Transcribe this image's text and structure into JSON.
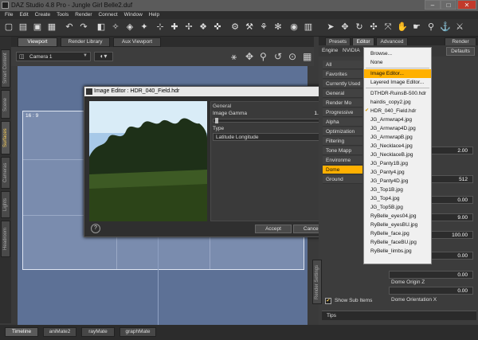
{
  "window": {
    "title": "DAZ Studio 4.8 Pro - Jungle Girl Belle2.duf",
    "min": "–",
    "max": "□",
    "close": "✕"
  },
  "menubar": [
    "File",
    "Edit",
    "Create",
    "Tools",
    "Render",
    "Connect",
    "Window",
    "Help"
  ],
  "left_tabs": [
    "Smart Content",
    "Scene",
    "Surfaces",
    "Cameras",
    "Lights",
    "Headroom"
  ],
  "viewport": {
    "tabs": [
      "Viewport",
      "Render Library",
      "Aux Viewport"
    ],
    "camera": "Camera 1",
    "aspect": "16 : 9"
  },
  "bottom_tabs": [
    "Timeline",
    "aniMate2",
    "rayMate",
    "graphMate"
  ],
  "dialog": {
    "title": "Image Editor : HDR_040_Field.hdr",
    "general_label": "General",
    "gamma_label": "Image Gamma",
    "gamma_value": "1.00",
    "type_label": "Type",
    "type_value": "Latitude Longitude",
    "accept": "Accept",
    "cancel": "Cancel",
    "help": "?"
  },
  "right_panel": {
    "tabs": [
      "Presets",
      "Editor",
      "Advanced"
    ],
    "render_tab": "Render",
    "sub": [
      "Engine",
      "NVIDIA"
    ],
    "defaults": "Defaults",
    "scene_items": [
      "All",
      "Favorites",
      "Currently Used",
      "General",
      "Render Mo",
      "Progressive",
      "Alpha",
      "Optimization",
      "Filtering",
      "Tone Mapp",
      "Environme",
      "Dome",
      "Ground"
    ],
    "props": [
      {
        "label": "Ground",
        "value": ""
      },
      {
        "label": "me",
        "value": ""
      },
      {
        "label": "ty",
        "value": ""
      },
      {
        "label": "",
        "value": "2.00"
      },
      {
        "label": "ng Resolution",
        "value": ""
      },
      {
        "label": "",
        "value": "512"
      },
      {
        "label": "ng Blur",
        "value": ""
      },
      {
        "label": "",
        "value": "0.00"
      },
      {
        "label": "ier",
        "value": ""
      },
      {
        "label": "",
        "value": "9.00"
      },
      {
        "label": "",
        "value": "100.00"
      },
      {
        "label": "",
        "value": "0.00"
      },
      {
        "label": "",
        "value": "0.00"
      },
      {
        "label": "",
        "value": "0.00"
      },
      {
        "label": "Dome Origin Z",
        "value": ""
      },
      {
        "label": "",
        "value": "0.00"
      },
      {
        "label": "Dome Orientation X",
        "value": ""
      }
    ],
    "show_sub_items": "Show Sub Items",
    "tips": "Tips",
    "render_settings": "Render Settings"
  },
  "context_menu": {
    "items": [
      "Browse...",
      "None",
      "Image Editor...",
      "Layered Image Editor...",
      "DTHDR-RuinsB-500.hdr",
      "hairdis_copy2.jpg",
      "HDR_040_Field.hdr",
      "JG_Armwrap4.jpg",
      "JG_Armwrap4D.jpg",
      "JG_ArmwrapB.jpg",
      "JG_Necklace4.jpg",
      "JG_NecklaceB.jpg",
      "JG_Panty1B.jpg",
      "JG_Panty4.jpg",
      "JG_Panty4D.jpg",
      "JG_Top1B.jpg",
      "JG_Top4.jpg",
      "JG_Top5B.jpg",
      "RyBelle_eyes04.jpg",
      "RyBelle_eyesBU.jpg",
      "RyBelle_face.jpg",
      "RyBelle_faceBU.jpg",
      "RyBelle_limbs.jpg"
    ],
    "highlighted_index": 2,
    "checked_index": 6
  },
  "colors": {
    "accent": "#ffb000",
    "viewport": "#5d7196",
    "panel": "#3c3c3c"
  }
}
